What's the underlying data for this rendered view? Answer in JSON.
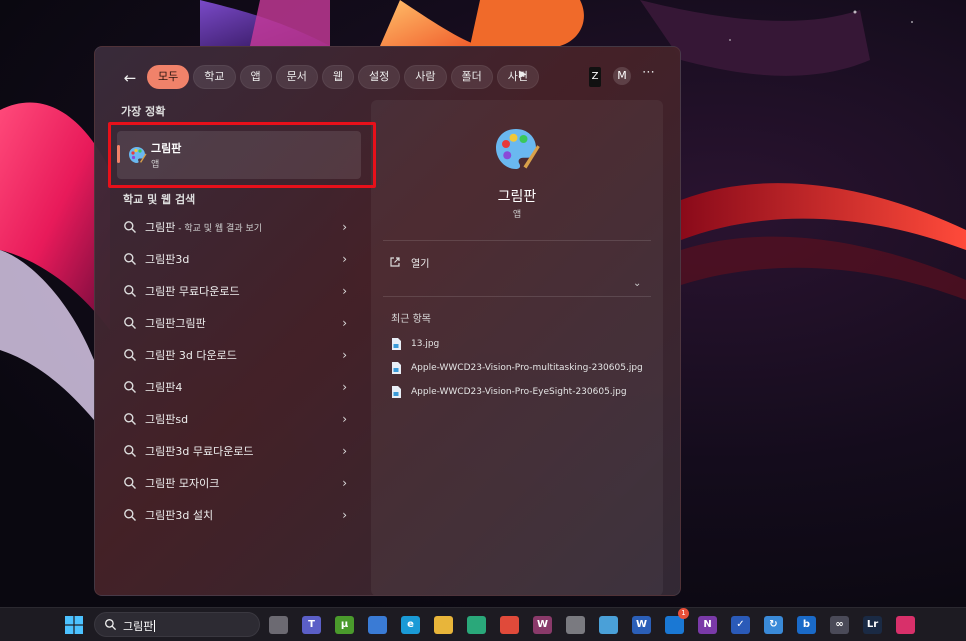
{
  "filters": {
    "back_label": "←",
    "chips": [
      "모두",
      "학교",
      "앱",
      "문서",
      "웹",
      "설정",
      "사람",
      "폴더",
      "사진"
    ],
    "more_label": "⋯",
    "play_label": "▶",
    "account_z": "Z",
    "account_m": "M"
  },
  "best_match": {
    "title": "가장 정확",
    "name": "그림판",
    "type": "앱"
  },
  "web_search": {
    "title": "학교 및 웹 검색",
    "first": {
      "term": "그림판",
      "suffix": " - 학교 및 웹 결과 보기"
    },
    "suggestions": [
      "그림판3d",
      "그림판 무료다운로드",
      "그림판그림판",
      "그림판 3d 다운로드",
      "그림판4",
      "그림판sd",
      "그림판3d 무료다운로드",
      "그림판 모자이크",
      "그림판3d 설치"
    ],
    "chevron": "›"
  },
  "detail": {
    "name": "그림판",
    "type": "앱",
    "open_label": "열기",
    "expand_icon": "⌄",
    "recent_title": "최근 항목",
    "recent": [
      "13.jpg",
      "Apple-WWCD23-Vision-Pro-multitasking-230605.jpg",
      "Apple-WWCD23-Vision-Pro-EyeSight-230605.jpg"
    ]
  },
  "taskbar": {
    "search_value": "그림판",
    "icons": [
      {
        "name": "task-view-icon",
        "color": "#6c6a72",
        "glyph": ""
      },
      {
        "name": "teams-icon",
        "color": "#5b5fc7",
        "glyph": "T"
      },
      {
        "name": "utorrent-icon",
        "color": "#4a9a2c",
        "glyph": "µ"
      },
      {
        "name": "store-icon",
        "color": "#3a7bd5",
        "glyph": ""
      },
      {
        "name": "edge-icon",
        "color": "#1a9ad6",
        "glyph": "e"
      },
      {
        "name": "file-explorer-icon",
        "color": "#e8b53a",
        "glyph": ""
      },
      {
        "name": "app-green-icon",
        "color": "#2aa87a",
        "glyph": ""
      },
      {
        "name": "chrome-icon",
        "color": "#e04a3a",
        "glyph": ""
      },
      {
        "name": "winrar-icon",
        "color": "#8a3a6a",
        "glyph": "W"
      },
      {
        "name": "photos-icon",
        "color": "#7a7a80",
        "glyph": ""
      },
      {
        "name": "notepad-icon",
        "color": "#4aa0d8",
        "glyph": ""
      },
      {
        "name": "word-icon",
        "color": "#2b5fb8",
        "glyph": "W"
      },
      {
        "name": "outlook-icon",
        "color": "#1a78d4",
        "glyph": ""
      },
      {
        "name": "onenote-icon",
        "color": "#7a3aa8",
        "glyph": "N"
      },
      {
        "name": "todo-icon",
        "color": "#2a5ab8",
        "glyph": "✓"
      },
      {
        "name": "sync-icon",
        "color": "#3a8ad8",
        "glyph": "↻"
      },
      {
        "name": "bing-icon",
        "color": "#1a6ac8",
        "glyph": "b"
      },
      {
        "name": "app-infinity-icon",
        "color": "#4a4a58",
        "glyph": "∞"
      },
      {
        "name": "lightroom-icon",
        "color": "#1a2a44",
        "glyph": "Lr"
      },
      {
        "name": "instagram-icon",
        "color": "#d8306a",
        "glyph": ""
      }
    ],
    "badge_count": "1"
  },
  "colors": {
    "accent": "#f0826a",
    "highlight": "#e8101a"
  }
}
